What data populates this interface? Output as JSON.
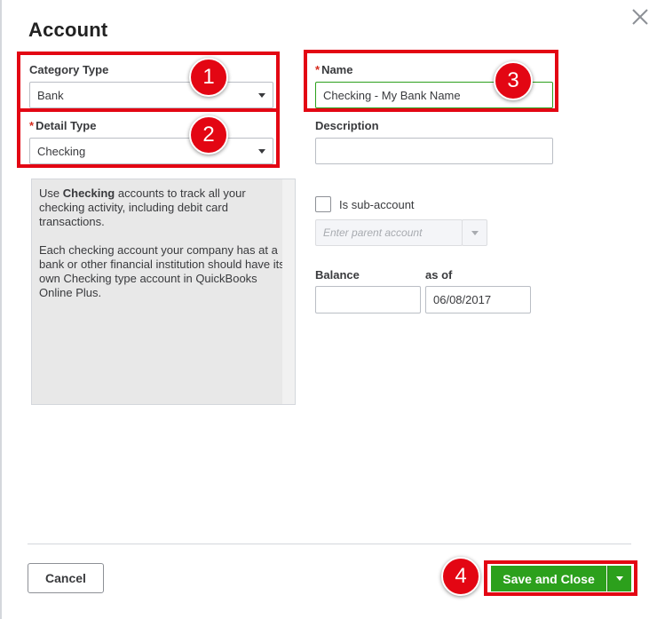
{
  "dialog": {
    "title": "Account"
  },
  "category_type": {
    "label": "Category Type",
    "value": "Bank",
    "badge": "1"
  },
  "detail_type": {
    "label": "Detail Type",
    "required_mark": "*",
    "value": "Checking",
    "badge": "2"
  },
  "name": {
    "label": "Name",
    "required_mark": "*",
    "value": "Checking - My Bank Name",
    "badge": "3"
  },
  "description": {
    "label": "Description",
    "value": ""
  },
  "help": {
    "p1_prefix": "Use ",
    "p1_bold": "Checking",
    "p1_suffix": " accounts to track all your checking activity, including debit card transactions.",
    "p2": "Each checking account your company has at a bank or other financial institution should have its own Checking type account in QuickBooks Online Plus."
  },
  "sub_account": {
    "label": "Is sub-account",
    "checked": false,
    "parent_placeholder": "Enter parent account"
  },
  "balance": {
    "label": "Balance",
    "value": ""
  },
  "as_of": {
    "label": "as of",
    "value": "06/08/2017"
  },
  "footer": {
    "cancel_label": "Cancel",
    "save_label": "Save and Close",
    "save_badge": "4"
  },
  "colors": {
    "accent_green": "#2ca01c",
    "annotation_red": "#e30613"
  }
}
